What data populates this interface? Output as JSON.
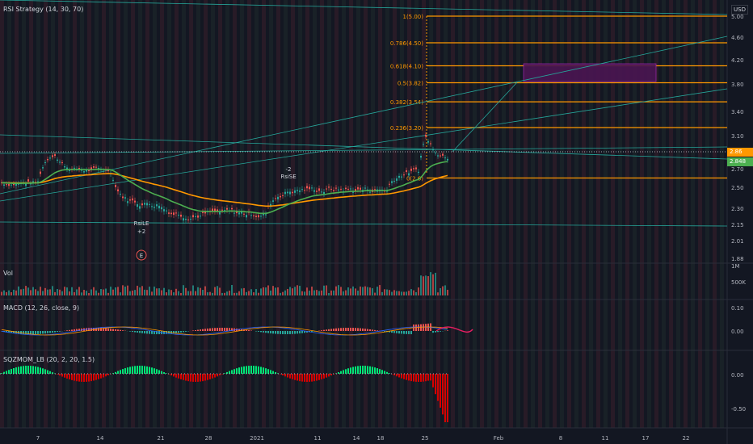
{
  "chart": {
    "title": "RSI Strategy (14, 30, 70)",
    "currency": "USD",
    "price_axis": [
      "5.00",
      "4.60",
      "4.20",
      "3.80",
      "3.40",
      "3.10",
      "2.70",
      "2.50",
      "2.30",
      "2.15",
      "2.01",
      "1.88"
    ],
    "current_price": "2.86",
    "tag2": "2.848",
    "fib_levels": [
      {
        "label": "1(5.00)",
        "price": 5.0
      },
      {
        "label": "0.786(4.50)",
        "price": 4.5
      },
      {
        "label": "0.618(4.10)",
        "price": 4.1
      },
      {
        "label": "0.5(3.82)",
        "price": 3.82
      },
      {
        "label": "0.382(3.54)",
        "price": 3.54
      },
      {
        "label": "0.236(3.20)",
        "price": 3.2
      },
      {
        "label": "0(2.6)",
        "price": 2.6
      }
    ],
    "signals": [
      {
        "name": "RsiLE",
        "qty": "+2"
      },
      {
        "name": "RsiSE",
        "qty": "-2"
      }
    ],
    "earnings_marker": "E"
  },
  "volume": {
    "label": "Vol",
    "axis": [
      "1M",
      "500K"
    ]
  },
  "macd": {
    "label": "MACD (12, 26, close, 9)",
    "axis": [
      "0.10",
      "0.00"
    ]
  },
  "sqzmom": {
    "label": "SQZMOM_LB (20, 2, 20, 1.5)",
    "axis": [
      "0.00",
      "-0.50"
    ]
  },
  "time_axis": [
    "7",
    "14",
    "21",
    "28",
    "2021",
    "11",
    "14",
    "18",
    "25",
    "Feb",
    "8",
    "11",
    "17",
    "22"
  ],
  "colors": {
    "background": "#131722",
    "fib": "#ff9800",
    "trend": "#26a69a",
    "ma_green": "#4caf50",
    "ma_orange": "#ff9800",
    "bull": "#26a69a",
    "bear": "#ef5350",
    "sqz_green": "#00e676",
    "sqz_red": "#d50000"
  }
}
